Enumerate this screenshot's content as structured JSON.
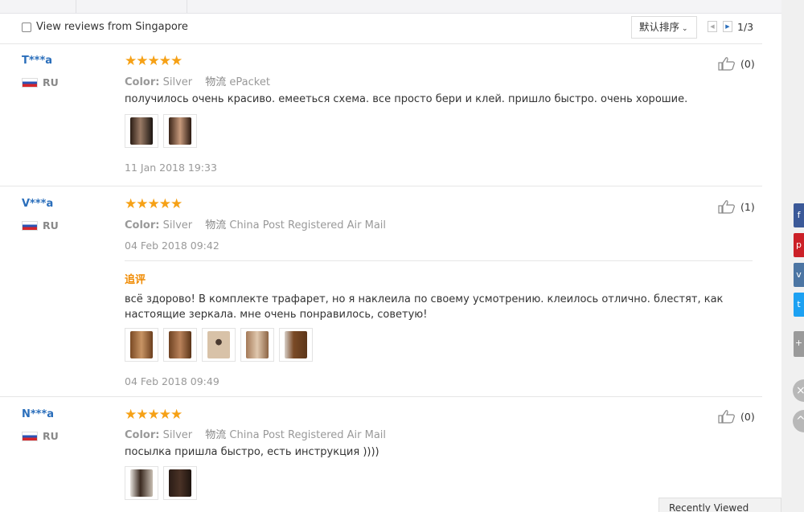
{
  "filter": {
    "checkbox_label": "View reviews from Singapore",
    "sort_label": "默认排序",
    "page_prev": "◀",
    "page_next": "▶",
    "page_indicator": "1/3"
  },
  "reviews": [
    {
      "user": "T***a",
      "country": "RU",
      "stars": "★★★★★",
      "color_key": "Color:",
      "color_value": "Silver",
      "logistics_key": "物流",
      "logistics_value": "ePacket",
      "text": "получилось очень красиво. емееться схема. все просто бери и клей. пришло быстро. очень хорошие.",
      "date": "11 Jan 2018 19:33",
      "likes": "(0)"
    },
    {
      "user": "V***a",
      "country": "RU",
      "stars": "★★★★★",
      "color_key": "Color:",
      "color_value": "Silver",
      "logistics_key": "物流",
      "logistics_value": "China Post Registered Air Mail",
      "date": "04 Feb 2018 09:42",
      "followup_label": "追评",
      "followup_text": "всё здорово! В комплекте трафарет, но я наклеила по своему усмотрению. клеилось отлично. блестят, как настоящие зеркала. мне очень понравилось, советую!",
      "followup_date": "04 Feb 2018 09:49",
      "likes": "(1)"
    },
    {
      "user": "N***a",
      "country": "RU",
      "stars": "★★★★★",
      "color_key": "Color:",
      "color_value": "Silver",
      "logistics_key": "物流",
      "logistics_value": "China Post Registered Air Mail",
      "text": "посылка пришла быстро, есть инструкция ))))",
      "likes": "(0)"
    }
  ],
  "sidebar": {
    "share_icons": [
      "facebook-icon",
      "pinterest-icon",
      "vk-icon",
      "twitter-icon",
      "more-share-icon"
    ],
    "recently_viewed": "Recently Viewed"
  },
  "colors": {
    "username": "#2a6ebb",
    "star": "#f6a116",
    "followup": "#f08a00",
    "facebook": "#3b5998",
    "pinterest": "#cb2027",
    "vk": "#4c75a3",
    "twitter": "#1da1f2"
  }
}
